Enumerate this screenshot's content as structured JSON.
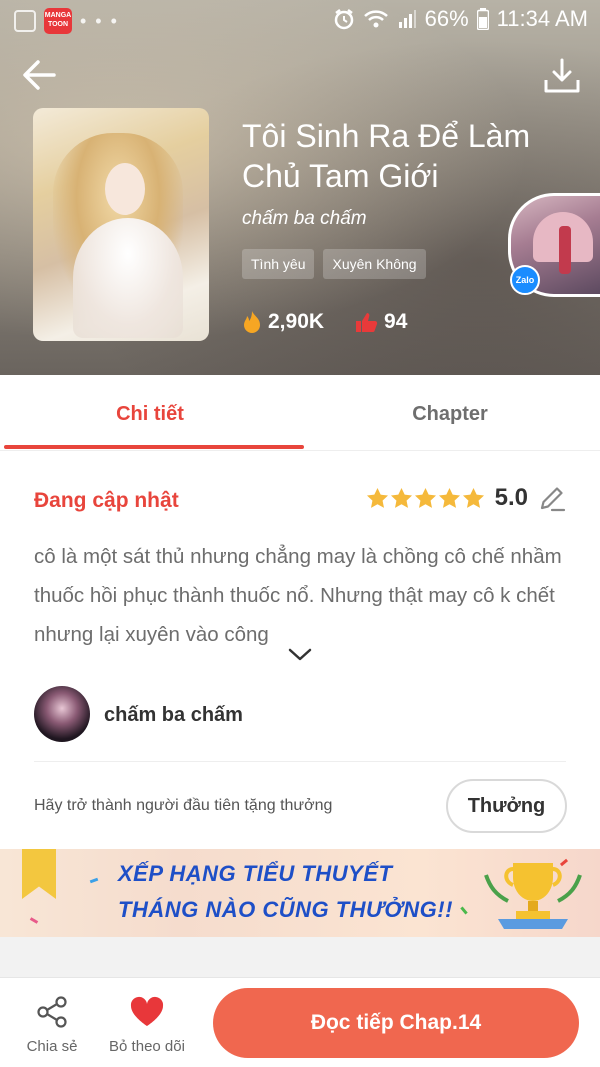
{
  "status_bar": {
    "app_badge": "MANGA TOON",
    "battery": "66%",
    "time": "11:34 AM"
  },
  "header": {
    "title": "Tôi Sinh Ra Để Làm Chủ Tam Giới",
    "author": "chấm ba chấm",
    "tags": [
      "Tình yêu",
      "Xuyên Không"
    ],
    "views": "2,90K",
    "likes": "94",
    "zalo_badge": "Zalo"
  },
  "tabs": [
    {
      "label": "Chi tiết",
      "active": true
    },
    {
      "label": "Chapter",
      "active": false
    }
  ],
  "details": {
    "status": "Đang cập nhật",
    "rating": "5.0",
    "stars": 5,
    "description": "cô là một sát thủ nhưng chẳng may là chồng cô chế nhầm thuốc hồi phục thành thuốc nổ. Nhưng thật may cô k chết nhưng lại xuyên vào công",
    "author_name": "chấm ba chấm",
    "reward_prompt": "Hãy trở thành người đầu tiên tặng thưởng",
    "reward_button": "Thưởng"
  },
  "banner": {
    "line1": "XẾP HẠNG TIỂU THUYẾT",
    "line2": "THÁNG NÀO CŨNG THƯỞNG!!"
  },
  "bottom_bar": {
    "share_label": "Chia sẻ",
    "follow_label": "Bỏ theo dõi",
    "read_button": "Đọc tiếp Chap.14"
  },
  "colors": {
    "accent": "#e8453c",
    "read_button": "#f0674f",
    "star": "#f5b93b",
    "banner_text": "#1e4fc7"
  }
}
